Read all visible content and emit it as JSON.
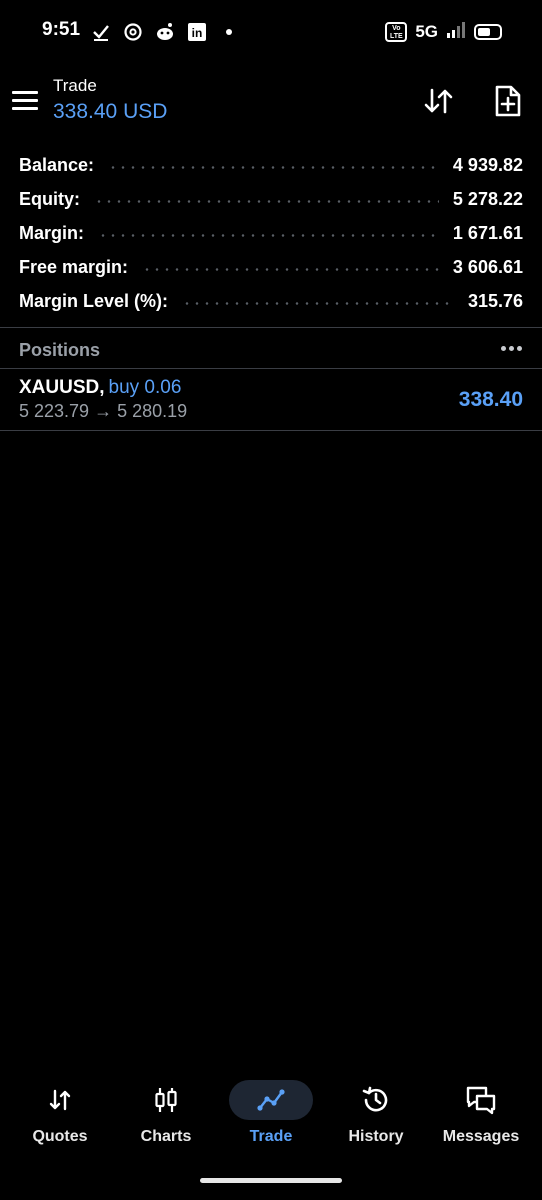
{
  "status_bar": {
    "time": "9:51",
    "volte_line1": "Vo",
    "volte_line2": "LTE",
    "network": "5G",
    "notification_icons": [
      "check-icon",
      "threads-icon",
      "reddit-icon",
      "linkedin-icon",
      "dot-icon"
    ],
    "linkedin_glyph": "in"
  },
  "header": {
    "title": "Trade",
    "profit_summary": "338.40 USD",
    "accent_color": "#5aa0f6"
  },
  "summary": {
    "rows": [
      {
        "label": "Balance:",
        "value": "4 939.82"
      },
      {
        "label": "Equity:",
        "value": "5 278.22"
      },
      {
        "label": "Margin:",
        "value": "1 671.61"
      },
      {
        "label": "Free margin:",
        "value": "3 606.61"
      },
      {
        "label": "Margin Level (%):",
        "value": "315.76"
      }
    ]
  },
  "positions": {
    "title": "Positions",
    "items": [
      {
        "symbol": "XAUUSD,",
        "side": "buy 0.06",
        "prices": "5 223.79 → 5 280.19",
        "profit": "338.40"
      }
    ]
  },
  "bottom_nav": {
    "items": [
      {
        "label": "Quotes",
        "icon": "quotes-icon",
        "active": false
      },
      {
        "label": "Charts",
        "icon": "charts-icon",
        "active": false
      },
      {
        "label": "Trade",
        "icon": "trade-icon",
        "active": true
      },
      {
        "label": "History",
        "icon": "history-icon",
        "active": false
      },
      {
        "label": "Messages",
        "icon": "messages-icon",
        "active": false
      }
    ]
  }
}
